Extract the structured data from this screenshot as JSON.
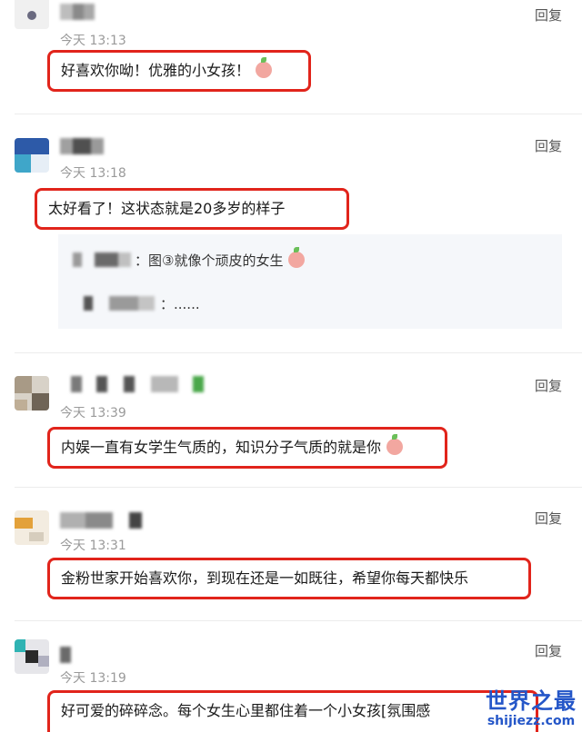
{
  "comments": [
    {
      "time": "今天 13:13",
      "reply_label": "回复",
      "text": "好喜欢你呦！优雅的小女孩！",
      "has_emoji": true
    },
    {
      "time": "今天 13:18",
      "reply_label": "回复",
      "text": "太好看了！这状态就是20多岁的样子",
      "has_emoji": false,
      "sub_replies": [
        {
          "text": "：图③就像个顽皮的女生",
          "has_emoji": true
        },
        {
          "text": "：......",
          "has_emoji": false
        }
      ]
    },
    {
      "time": "今天 13:39",
      "reply_label": "回复",
      "text": "内娱一直有女学生气质的，知识分子气质的就是你",
      "has_emoji": true
    },
    {
      "time": "今天 13:31",
      "reply_label": "回复",
      "text": "金粉世家开始喜欢你，到现在还是一如既往，希望你每天都快乐",
      "has_emoji": false
    },
    {
      "time": "今天 13:19",
      "reply_label": "回复",
      "text": "好可爱的碎碎念。每个女生心里都住着一个小女孩[氛围感",
      "has_emoji": false
    }
  ],
  "watermark": {
    "main": "世界之最",
    "sub": "shijiezz.com"
  },
  "colors": {
    "highlight_border": "#e1241b",
    "time": "#9a9a9a",
    "panel": "#f5f7fa"
  }
}
